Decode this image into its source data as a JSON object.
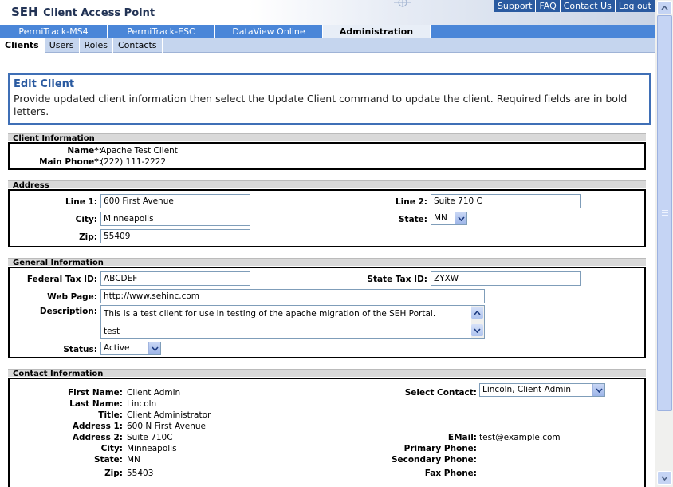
{
  "header": {
    "brand_seh": "SEH",
    "brand_title": "Client Access Point",
    "links": [
      "Support",
      "FAQ",
      "Contact Us",
      "Log out"
    ]
  },
  "main_tabs": [
    "PermiTrack-MS4",
    "PermiTrack-ESC",
    "DataView Online",
    "Administration"
  ],
  "sub_tabs": [
    "Clients",
    "Users",
    "Roles",
    "Contacts"
  ],
  "edit": {
    "title": "Edit Client",
    "description": "Provide updated client information then select the Update Client command to update the client. Required fields are in bold letters."
  },
  "client_info": {
    "heading": "Client Information",
    "name_label": "Name*:",
    "name_value": "Apache Test Client",
    "phone_label": "Main Phone*:",
    "phone_value": "(222) 111-2222"
  },
  "address": {
    "heading": "Address",
    "line1_label": "Line 1:",
    "line1_value": "600 First Avenue",
    "line2_label": "Line 2:",
    "line2_value": "Suite 710 C",
    "city_label": "City:",
    "city_value": "Minneapolis",
    "state_label": "State:",
    "state_value": "MN",
    "zip_label": "Zip:",
    "zip_value": "55409"
  },
  "general": {
    "heading": "General Information",
    "fed_tax_label": "Federal Tax ID:",
    "fed_tax_value": "ABCDEF",
    "state_tax_label": "State Tax ID:",
    "state_tax_value": "ZYXW",
    "web_label": "Web Page:",
    "web_value": "http://www.sehinc.com",
    "desc_label": "Description:",
    "desc_line1": "This is a test client for use in testing of the apache migration of the SEH Portal.",
    "desc_line2": "test",
    "status_label": "Status:",
    "status_value": "Active"
  },
  "contact": {
    "heading": "Contact Information",
    "first_name_label": "First Name:",
    "first_name_value": "Client Admin",
    "last_name_label": "Last Name:",
    "last_name_value": "Lincoln",
    "title_label": "Title:",
    "title_value": "Client Administrator",
    "address1_label": "Address 1:",
    "address1_value": "600 N First Avenue",
    "address2_label": "Address 2:",
    "address2_value": "Suite 710C",
    "city_label": "City:",
    "city_value": "Minneapolis",
    "state_label": "State:",
    "state_value": "MN",
    "zip_label": "Zip:",
    "zip_value": "55403",
    "select_label": "Select Contact:",
    "select_value": "Lincoln, Client Admin",
    "email_label": "EMail:",
    "email_value": "test@example.com",
    "primary_phone_label": "Primary Phone:",
    "secondary_phone_label": "Secondary Phone:",
    "fax_label": "Fax Phone:"
  },
  "colors": {
    "brand_blue": "#2a5aa0",
    "tab_blue": "#4a86d8",
    "subtab_bg": "#c5d5ee",
    "section_header": "#d9d9d9"
  }
}
